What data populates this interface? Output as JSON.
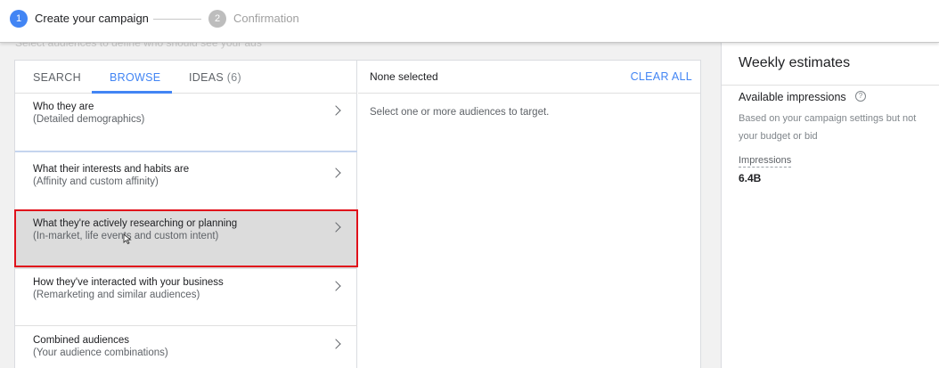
{
  "stepper": {
    "step1": {
      "number": "1",
      "label": "Create your campaign"
    },
    "step2": {
      "number": "2",
      "label": "Confirmation"
    }
  },
  "faded_instruction": "Select audiences to define who should see your ads",
  "tabs": {
    "search": "SEARCH",
    "browse": "BROWSE",
    "ideas": "IDEAS",
    "ideas_count": "(6)"
  },
  "categories": [
    {
      "title": "Who they are",
      "subtitle": "(Detailed demographics)"
    },
    {
      "title": "What their interests and habits are",
      "subtitle": "(Affinity and custom affinity)"
    },
    {
      "title": "What they're actively researching or planning",
      "subtitle": "(In-market, life events and custom intent)"
    },
    {
      "title": "How they've interacted with your business",
      "subtitle": "(Remarketing and similar audiences)"
    },
    {
      "title": "Combined audiences",
      "subtitle": "(Your audience combinations)"
    }
  ],
  "selection": {
    "none_selected": "None selected",
    "clear_all": "CLEAR ALL",
    "hint": "Select one or more audiences to target."
  },
  "estimates": {
    "title": "Weekly estimates",
    "available_impressions": "Available impressions",
    "help_glyph": "?",
    "note": "Based on your campaign settings but not your budget or bid",
    "impressions_label": "Impressions",
    "impressions_value": "6.4B"
  },
  "colors": {
    "accent": "#4285f4",
    "highlight_border": "#e0111b",
    "hover_row": "#dcdcdc"
  },
  "icons": {
    "chevron": "chevron-right-icon",
    "help": "help-circle-icon",
    "cursor": "mouse-pointer-icon"
  }
}
